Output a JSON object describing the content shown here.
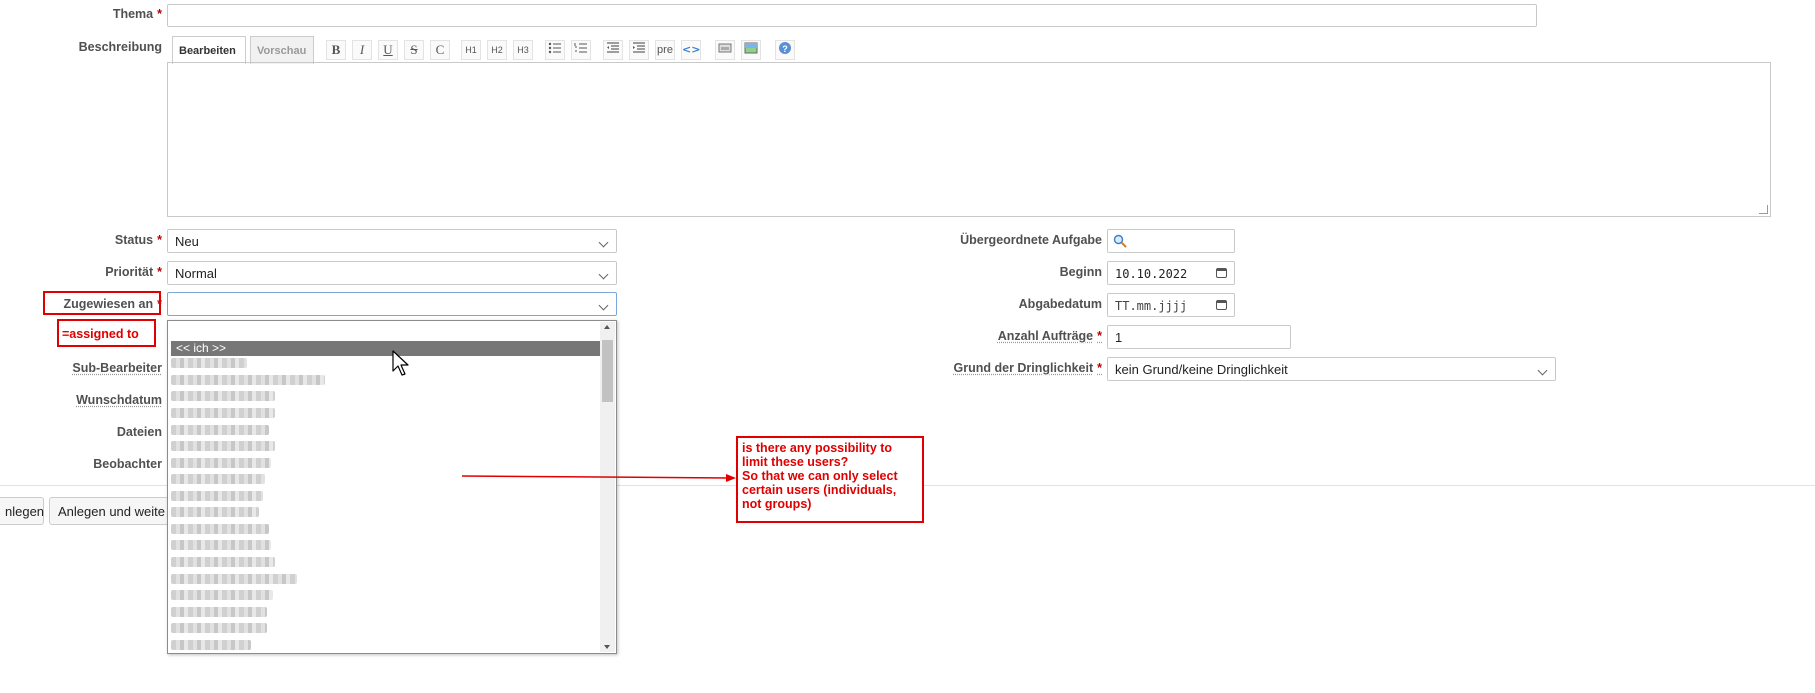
{
  "form": {
    "subject_label": "Thema",
    "description_label": "Beschreibung",
    "required_marker": "*",
    "editor_tabs": [
      "Bearbeiten",
      "Vorschau"
    ],
    "toolbar": {
      "bold": "B",
      "italic": "I",
      "underline": "U",
      "strike": "S",
      "code": "C",
      "h1": "H1",
      "h2": "H2",
      "h3": "H3",
      "pre": "pre"
    },
    "status_label": "Status",
    "status_value": "Neu",
    "priority_label": "Priorität",
    "priority_value": "Normal",
    "assignee_label": "Zugewiesen an",
    "assignee_value": "",
    "sub_assignee_label": "Sub-Bearbeiter",
    "wish_date_label": "Wunschdatum",
    "files_label": "Dateien",
    "watchers_label": "Beobachter",
    "parent_task_label": "Übergeordnete Aufgabe",
    "start_label": "Beginn",
    "start_value": "10.10.2022",
    "due_label": "Abgabedatum",
    "due_placeholder": "TT.mm.jjjj",
    "count_label": "Anzahl Aufträge",
    "count_value": "1",
    "urgency_label": "Grund der Dringlichkeit",
    "urgency_value": "kein Grund/keine Dringlichkeit"
  },
  "dropdown": {
    "first_option": "<< ich >>"
  },
  "buttons": {
    "create": "nlegen",
    "create_continue": "Anlegen und weite"
  },
  "annotations": {
    "assigned_to": "=assigned to",
    "question_lines": [
      "is there any possibility to",
      "limit these users?",
      "So that we can only select",
      "certain users (individuals,",
      "not groups)"
    ],
    "color": "#e00000"
  }
}
